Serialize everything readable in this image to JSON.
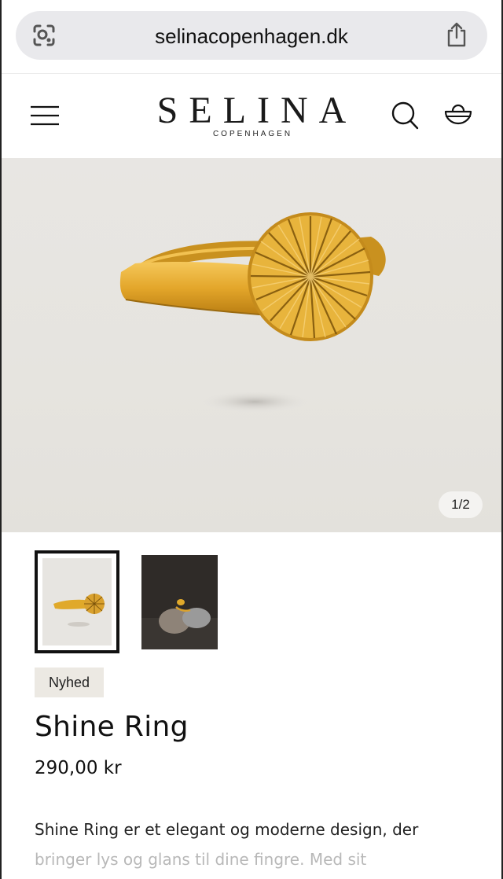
{
  "browser": {
    "url": "selinacopenhagen.dk"
  },
  "header": {
    "logo_main": "SELINA",
    "logo_sub": "COPENHAGEN"
  },
  "gallery": {
    "counter": "1/2"
  },
  "product": {
    "badge": "Nyhed",
    "title": "Shine Ring",
    "price": "290,00 kr",
    "description_line1": "Shine Ring er et elegant og moderne design, der",
    "description_line2": "bringer lys og glans til dine fingre. Med sit"
  },
  "colors": {
    "gold": "#e0a92a",
    "hero_bg": "#e7e5e1",
    "badge_bg": "#ece9e3"
  }
}
